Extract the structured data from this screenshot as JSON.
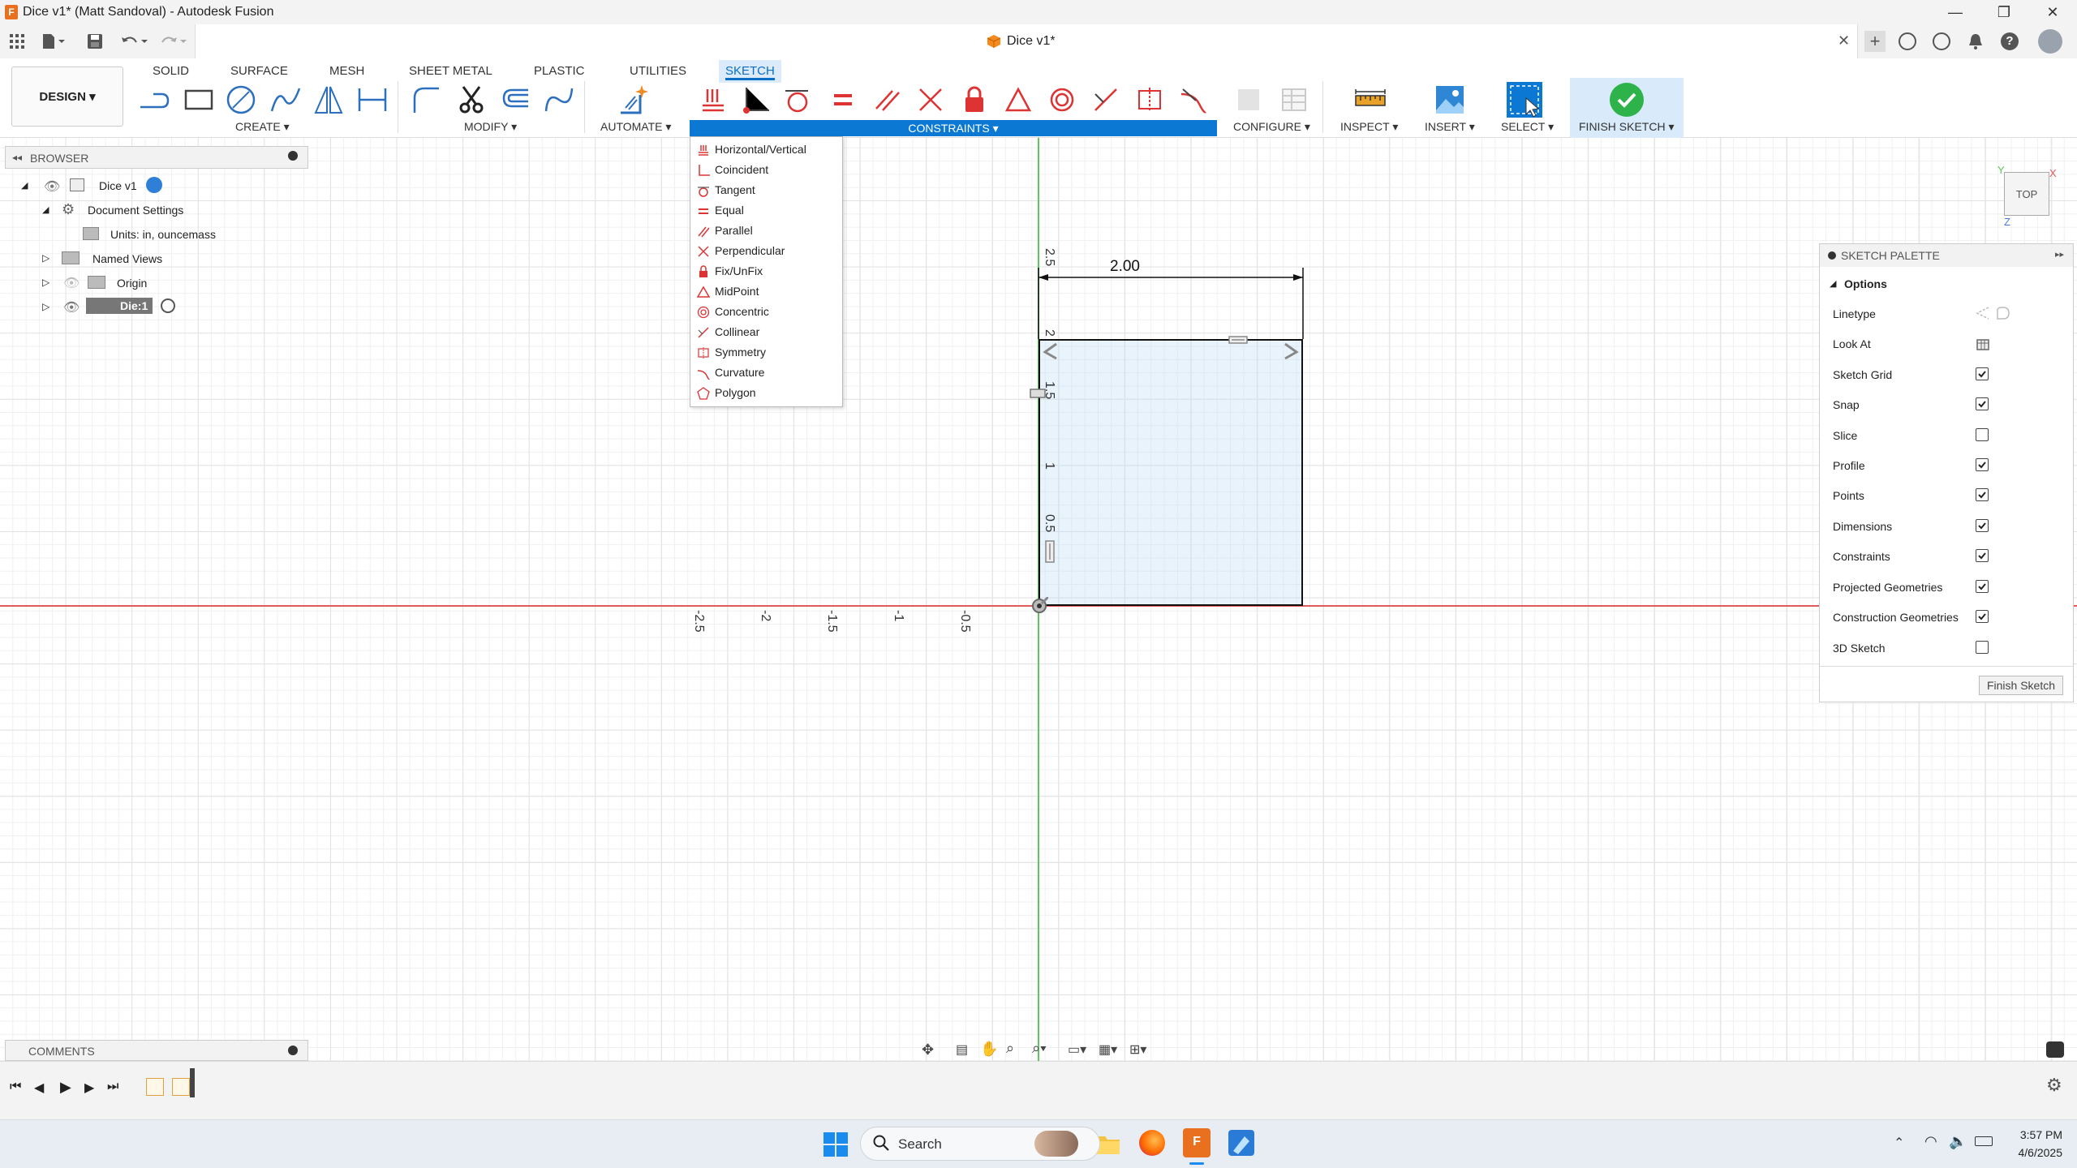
{
  "window": {
    "title": "Dice v1* (Matt Sandoval) - Autodesk Fusion",
    "doc_tab": "Dice v1*"
  },
  "ribbon": {
    "tabs": [
      "SOLID",
      "SURFACE",
      "MESH",
      "SHEET METAL",
      "PLASTIC",
      "UTILITIES",
      "SKETCH"
    ],
    "active_tab": "SKETCH",
    "workspace": "DESIGN ▾",
    "groups": {
      "create": "CREATE ▾",
      "modify": "MODIFY ▾",
      "automate": "AUTOMATE ▾",
      "constraints": "CONSTRAINTS ▾",
      "configure": "CONFIGURE ▾",
      "inspect": "INSPECT ▾",
      "insert": "INSERT ▾",
      "select": "SELECT ▾",
      "finish": "FINISH SKETCH ▾"
    }
  },
  "browser": {
    "title": "BROWSER",
    "root": "Dice v1",
    "document_settings": "Document Settings",
    "units": "Units: in, ouncemass",
    "named_views": "Named Views",
    "origin": "Origin",
    "component": "Die:1"
  },
  "constraints_menu": [
    "Horizontal/Vertical",
    "Coincident",
    "Tangent",
    "Equal",
    "Parallel",
    "Perpendicular",
    "Fix/UnFix",
    "MidPoint",
    "Concentric",
    "Collinear",
    "Symmetry",
    "Curvature",
    "Polygon"
  ],
  "sketch": {
    "dimension": "2.00",
    "x_ticks": [
      "-2.5",
      "-2",
      "-1.5",
      "-1",
      "-0.5"
    ],
    "y_ticks": [
      "2.5",
      "2",
      "1.5",
      "1",
      "0.5"
    ]
  },
  "viewcube": {
    "label": "TOP",
    "axes": {
      "x": "X",
      "y": "Y",
      "z": "Z"
    }
  },
  "palette": {
    "title": "SKETCH PALETTE",
    "section": "Options",
    "rows": [
      {
        "label": "Linetype",
        "kind": "icons"
      },
      {
        "label": "Look At",
        "kind": "icon"
      },
      {
        "label": "Sketch Grid",
        "checked": true
      },
      {
        "label": "Snap",
        "checked": true
      },
      {
        "label": "Slice",
        "checked": false
      },
      {
        "label": "Profile",
        "checked": true
      },
      {
        "label": "Points",
        "checked": true
      },
      {
        "label": "Dimensions",
        "checked": true
      },
      {
        "label": "Constraints",
        "checked": true
      },
      {
        "label": "Projected Geometries",
        "checked": true
      },
      {
        "label": "Construction Geometries",
        "checked": true
      },
      {
        "label": "3D Sketch",
        "checked": false
      }
    ],
    "finish_button": "Finish Sketch"
  },
  "comments": {
    "title": "COMMENTS"
  },
  "taskbar": {
    "search_placeholder": "Search",
    "time": "3:57 PM",
    "date": "4/6/2025"
  },
  "colors": {
    "accent": "#0b78d4",
    "sketch_fill": "#e8f3fb",
    "x_axis": "#e05a5a",
    "y_axis": "#5ac85a",
    "finish_green": "#2db34a"
  }
}
